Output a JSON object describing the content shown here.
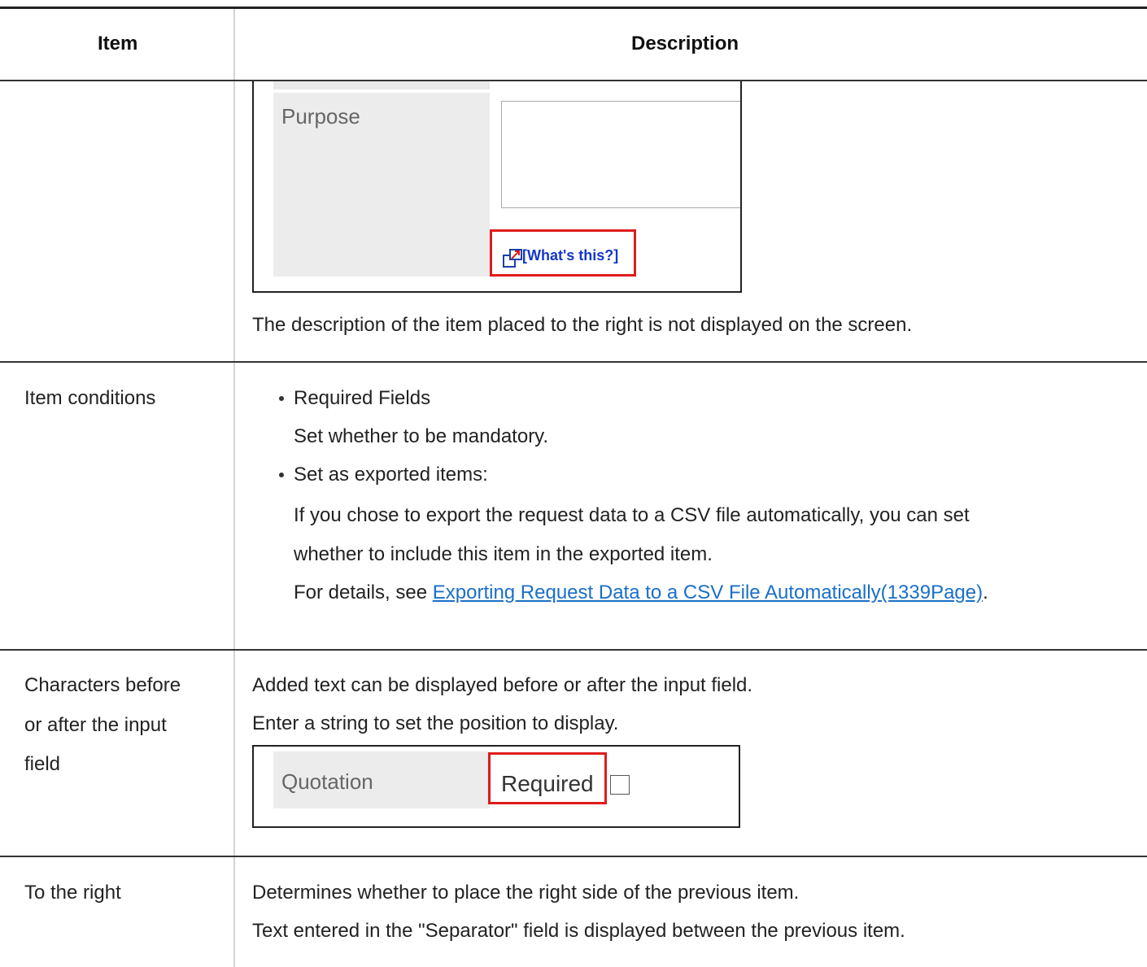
{
  "header": {
    "item": "Item",
    "description": "Description"
  },
  "rows": [
    {
      "item": "",
      "screenshot": {
        "label": "Purpose",
        "help_link": "[What's this?]"
      },
      "text": "The description of the item placed to the right is not displayed on the screen."
    },
    {
      "item": "Item conditions",
      "bullets": [
        {
          "title": "Required Fields",
          "lines": [
            "Set whether to be mandatory."
          ]
        },
        {
          "title": "Set as exported items:",
          "lines": [
            "If you chose to export the request data to a CSV file automatically, you can set",
            "whether to include this item in the exported item."
          ],
          "details_prefix": "For details, see ",
          "details_link": "Exporting Request Data to a CSV File Automatically(1339Page)",
          "details_suffix": "."
        }
      ]
    },
    {
      "item_lines": [
        "Characters before",
        "or after the input",
        "field"
      ],
      "text_lines": [
        "Added text can be displayed before or after the input field.",
        "Enter a string to set the position to display."
      ],
      "screenshot": {
        "label": "Quotation",
        "value": "Required"
      }
    },
    {
      "item": "To the right",
      "text_lines": [
        "Determines whether to place the right side of the previous item.",
        "Text entered in the \"Separator\" field is displayed between the previous item."
      ]
    }
  ],
  "colors": {
    "link": "#1a6fc9",
    "highlight_border": "#e01b1b",
    "help_link": "#1437c8"
  }
}
